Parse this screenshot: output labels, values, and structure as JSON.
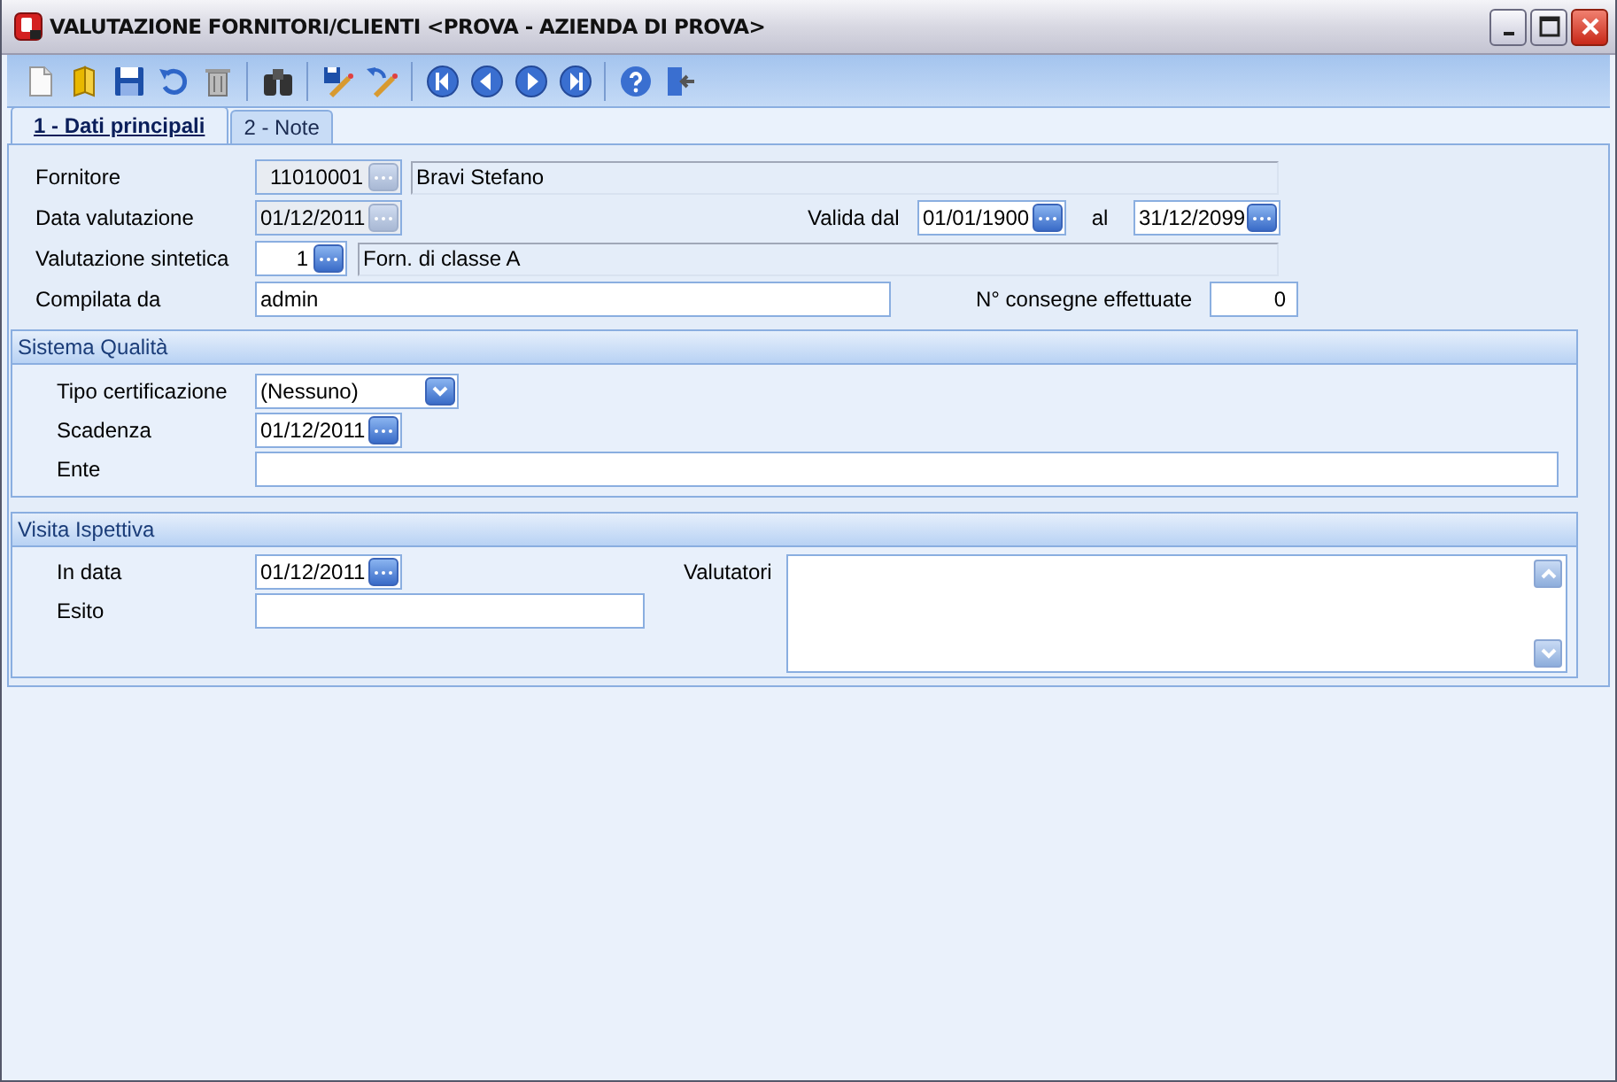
{
  "window": {
    "title": "VALUTAZIONE FORNITORI/CLIENTI <PROVA - AZIENDA DI PROVA>"
  },
  "tabs": [
    {
      "label": "1 - Dati principali",
      "selected": true
    },
    {
      "label": "2 - Note",
      "selected": false
    }
  ],
  "fornitore": {
    "label": "Fornitore",
    "code": "11010001",
    "description": "Bravi Stefano",
    "disabled": true
  },
  "data_valutazione": {
    "label": "Data valutazione",
    "value": "01/12/2011",
    "disabled": true
  },
  "validita": {
    "label": "Valida dal",
    "from": "01/01/1900",
    "to_label": "al",
    "to": "31/12/2099"
  },
  "valutazione_sintetica": {
    "label": "Valutazione sintetica",
    "value": "1",
    "description": "Forn. di classe A"
  },
  "compilata_da": {
    "label": "Compilata da",
    "value": "admin"
  },
  "consegne": {
    "label": "N° consegne effettuate",
    "value": "0"
  },
  "sistema_qualita": {
    "title": "Sistema Qualità",
    "tipo": {
      "label": "Tipo certificazione",
      "value": "(Nessuno)"
    },
    "scadenza": {
      "label": "Scadenza",
      "value": "01/12/2011"
    },
    "ente": {
      "label": "Ente"
    }
  },
  "visita_ispettiva": {
    "title": "Visita Ispettiva",
    "in_data": {
      "label": "In data",
      "value": "01/12/2011"
    },
    "esito": {
      "label": "Esito"
    },
    "valutatori": {
      "label": "Valutatori"
    }
  }
}
